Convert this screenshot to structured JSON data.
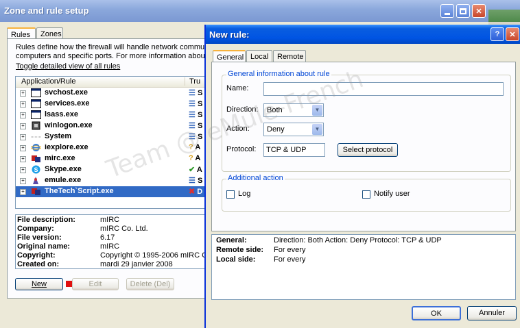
{
  "main_window": {
    "title": "Zone and rule setup",
    "tabs": [
      "Rules",
      "Zones"
    ],
    "intro_line1": "Rules define how the firewall will handle network communi",
    "intro_line2": "computers and specific ports. For more information about",
    "toggle_link": "Toggle detailed view of all rules",
    "list_headers": {
      "app": "Application/Rule",
      "trust": "Tru"
    },
    "apps": [
      {
        "name": "svchost.exe",
        "icon": "window-icon",
        "trust": "S"
      },
      {
        "name": "services.exe",
        "icon": "window-icon",
        "trust": "S"
      },
      {
        "name": "lsass.exe",
        "icon": "window-icon",
        "trust": "S"
      },
      {
        "name": "winlogon.exe",
        "icon": "lock-icon",
        "trust": "S"
      },
      {
        "name": "System",
        "icon": "dots-icon",
        "trust": "S"
      },
      {
        "name": "iexplore.exe",
        "icon": "ie-icon",
        "trust": "A"
      },
      {
        "name": "mirc.exe",
        "icon": "mirc-icon",
        "trust": "A"
      },
      {
        "name": "Skype.exe",
        "icon": "skype-icon",
        "trust": "A"
      },
      {
        "name": "emule.exe",
        "icon": "emule-icon",
        "trust": "S"
      },
      {
        "name": "TheTech`Script.exe",
        "icon": "script-icon",
        "trust": "D"
      }
    ],
    "info": [
      {
        "label": "File description:",
        "value": "mIRC"
      },
      {
        "label": "Company:",
        "value": "mIRC Co. Ltd."
      },
      {
        "label": "File version:",
        "value": "6.17"
      },
      {
        "label": "Original name:",
        "value": "mIRC"
      },
      {
        "label": "Copyright:",
        "value": "Copyright © 1995-2006 mIRC C"
      },
      {
        "label": "Created on:",
        "value": "mardi 29 janvier 2008"
      }
    ],
    "buttons": {
      "new": "New",
      "edit": "Edit",
      "delete": "Delete (Del)"
    }
  },
  "dialog": {
    "title": "New rule:",
    "tabs": [
      "General",
      "Local",
      "Remote"
    ],
    "group_general": "General information about rule",
    "name_label": "Name:",
    "name_value": "",
    "direction_label": "Direction:",
    "direction_value": "Both",
    "action_label": "Action:",
    "action_value": "Deny",
    "protocol_label": "Protocol:",
    "protocol_value": "TCP & UDP",
    "select_protocol_button": "Select protocol",
    "group_additional": "Additional action",
    "log_label": "Log",
    "notify_label": "Notify user",
    "summary": {
      "general_label": "General:",
      "general_value": "Direction: Both   Action: Deny   Protocol: TCP & UDP",
      "remote_label": "Remote side:",
      "remote_value": "For every",
      "local_label": "Local side:",
      "local_value": "For every"
    },
    "ok_button": "OK",
    "cancel_button": "Annuler"
  },
  "watermark": "Team @ eMule-French",
  "colors": {
    "selection": "#316ac5",
    "dialog_title": "#0054e3"
  }
}
